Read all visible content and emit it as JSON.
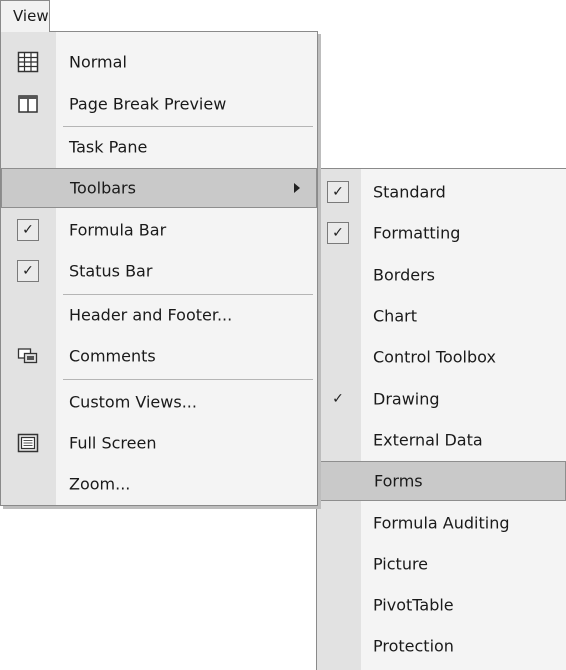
{
  "menubar": {
    "title": "View"
  },
  "view_menu": {
    "items": [
      {
        "label": "Normal",
        "icon": "normal-view-icon"
      },
      {
        "label": "Page Break Preview",
        "icon": "page-break-preview-icon"
      },
      {
        "label": "Task Pane"
      },
      {
        "label": "Toolbars",
        "submenu": true,
        "highlighted": true
      },
      {
        "label": "Formula Bar",
        "checked": true
      },
      {
        "label": "Status Bar",
        "checked": true
      },
      {
        "label": "Header and Footer..."
      },
      {
        "label": "Comments",
        "icon": "comments-icon"
      },
      {
        "label": "Custom Views..."
      },
      {
        "label": "Full Screen",
        "icon": "full-screen-icon"
      },
      {
        "label": "Zoom..."
      }
    ]
  },
  "toolbars_submenu": {
    "items": [
      {
        "label": "Standard",
        "checked": true
      },
      {
        "label": "Formatting",
        "checked": true
      },
      {
        "label": "Borders",
        "checked": false
      },
      {
        "label": "Chart",
        "checked": false
      },
      {
        "label": "Control Toolbox",
        "checked": false
      },
      {
        "label": "Drawing",
        "checked": true
      },
      {
        "label": "External Data",
        "checked": false
      },
      {
        "label": "Forms",
        "checked": false,
        "highlighted": true
      },
      {
        "label": "Formula Auditing",
        "checked": false
      },
      {
        "label": "Picture",
        "checked": false
      },
      {
        "label": "PivotTable",
        "checked": false
      },
      {
        "label": "Protection",
        "checked": false
      }
    ]
  },
  "glyphs": {
    "check": "✓"
  },
  "colors": {
    "menu_bg": "#f4f4f4",
    "gutter_bg": "#e2e2e2",
    "highlight_bg": "#c9c9c9",
    "border": "#8a8a8a"
  }
}
